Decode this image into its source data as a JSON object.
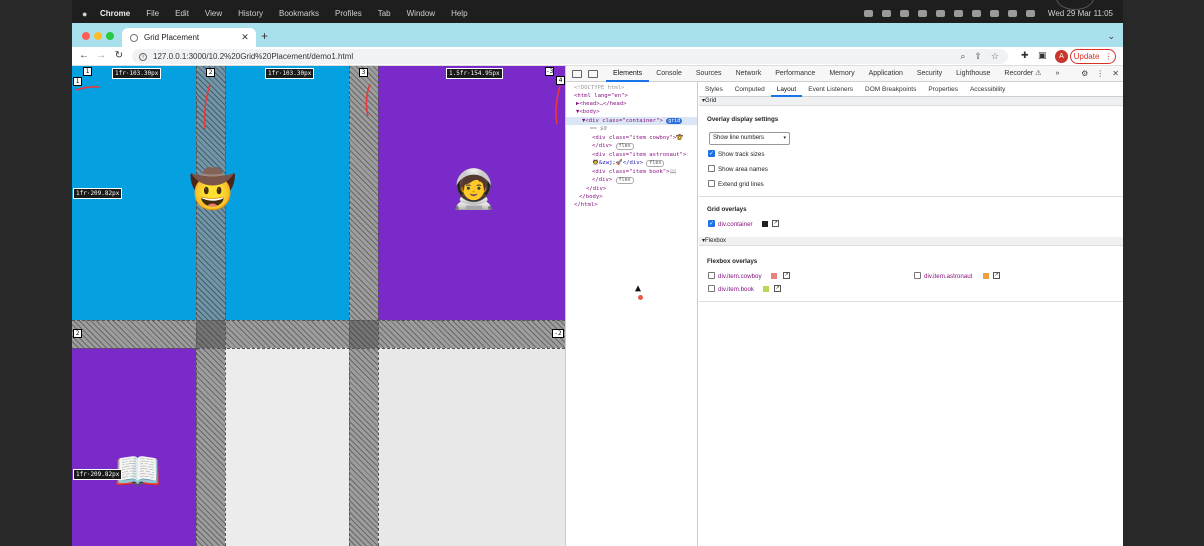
{
  "menubar": {
    "app": "Chrome",
    "items": [
      "File",
      "Edit",
      "View",
      "History",
      "Bookmarks",
      "Profiles",
      "Tab",
      "Window",
      "Help"
    ],
    "clock": "Wed 29 Mar  11:05"
  },
  "tab": {
    "title": "Grid Placement"
  },
  "toolbar": {
    "url": "127.0.0.1:3000/10.2%20Grid%20Placement/demo1.html",
    "avatar_initial": "A",
    "update_label": "Update"
  },
  "grid_overlay": {
    "top_line_numbers": [
      "1",
      "2",
      "3",
      "-3"
    ],
    "right_line_number": "4",
    "left_row_numbers": [
      "1",
      "2"
    ],
    "right_row_number": "-2",
    "track_sizes": {
      "col1": "1fr·103.30px",
      "col2": "1fr·103.30px",
      "col3": "1.5fr·154.95px",
      "row1": "1fr·209.82px",
      "row2": "1fr·209.82px"
    },
    "items": {
      "cowboy": "🤠",
      "astronaut": "🧑‍🚀",
      "book": "📖"
    }
  },
  "devtools": {
    "tabs": [
      "Elements",
      "Console",
      "Sources",
      "Network",
      "Performance",
      "Memory",
      "Application",
      "Security",
      "Lighthouse",
      "Recorder ⚠",
      "»"
    ],
    "active_tab": "Elements",
    "dom": {
      "doctype": "<!DOCTYPE html>",
      "html_open": "<html lang=\"en\">",
      "head": "▶<head>…</head>",
      "body_open": "▼<body>",
      "container": "▼<div class=\"container\">",
      "grid_badge": "grid",
      "dollar": "== $0",
      "cowboy_div": "<div class=\"item cowboy\">🤠",
      "div_close": "</div>",
      "flex_badge": "flex",
      "astronaut_div": "<div class=\"item astronaut\">",
      "astronaut_text": "🧑‍🚀&zwj;🚀</div>",
      "book_div": "<div class=\"item book\">📖",
      "body_close": "</body>",
      "html_close": "</html>"
    },
    "side_tabs": [
      "Styles",
      "Computed",
      "Layout",
      "Event Listeners",
      "DOM Breakpoints",
      "Properties",
      "Accessibility"
    ],
    "active_side_tab": "Layout",
    "layout": {
      "grid_header": "Grid",
      "overlay_settings_title": "Overlay display settings",
      "line_select_value": "Show line numbers",
      "show_track_sizes": "Show track sizes",
      "show_area_names": "Show area names",
      "extend_grid_lines": "Extend grid lines",
      "grid_overlays_title": "Grid overlays",
      "grid_overlay_item": "div.container",
      "grid_overlay_color": "#202020",
      "flexbox_header": "Flexbox",
      "flexbox_overlays_title": "Flexbox overlays",
      "flex_items": [
        {
          "label": "div.item.cowboy",
          "color": "#e88080"
        },
        {
          "label": "div.item.astronaut",
          "color": "#e8a040"
        },
        {
          "label": "div.item.book",
          "color": "#b8d858"
        }
      ]
    }
  },
  "colors": {
    "blue_cell": "#05a0e0",
    "purple_cell": "#7a2ac8",
    "tabstrip": "#a8e1ec",
    "accent": "#1a73e8"
  }
}
